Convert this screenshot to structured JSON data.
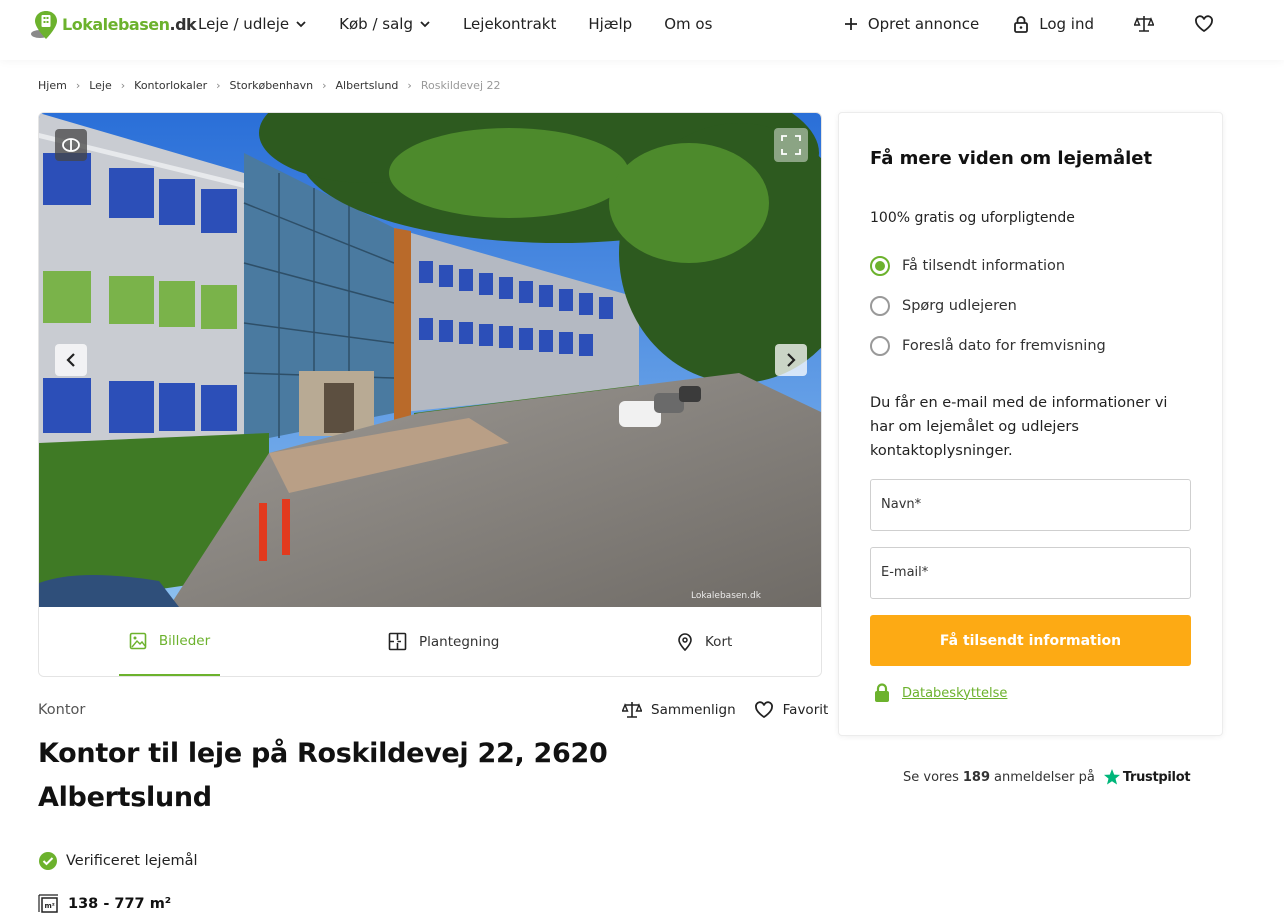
{
  "header": {
    "logo_text": "Lokalebasen",
    "logo_tld": ".dk",
    "nav": [
      {
        "label": "Leje / udleje"
      },
      {
        "label": "Køb / salg"
      },
      {
        "label": "Lejekontrakt"
      },
      {
        "label": "Hjælp"
      },
      {
        "label": "Om os"
      }
    ],
    "create_listing": "Opret annonce",
    "login": "Log ind"
  },
  "breadcrumb": [
    "Hjem",
    "Leje",
    "Kontorlokaler",
    "Storkøbenhavn",
    "Albertslund",
    "Roskildevej 22"
  ],
  "gallery": {
    "watermark": "Lokalebasen.dk",
    "tabs": [
      "Billeder",
      "Plantegning",
      "Kort"
    ],
    "active_tab": "Billeder"
  },
  "listing": {
    "category": "Kontor",
    "compare": "Sammenlign",
    "favorite": "Favorit",
    "title": "Kontor til leje på Roskildevej 22, 2620 Albertslund",
    "verified": "Verificeret lejemål",
    "size": "138 - 777 m²"
  },
  "form": {
    "title": "Få mere viden om lejemålet",
    "subtitle": "100% gratis og uforpligtende",
    "options": [
      "Få tilsendt information",
      "Spørg udlejeren",
      "Foreslå dato for fremvisning"
    ],
    "selected_option": "Få tilsendt information",
    "info": "Du får en e-mail med de informationer vi har om lejemålet og udlejers kontaktoplysninger.",
    "name_placeholder": "Navn*",
    "email_placeholder": "E-mail*",
    "submit": "Få tilsendt information",
    "privacy": "Databeskyttelse"
  },
  "trustpilot": {
    "prefix": "Se vores",
    "count": "189",
    "suffix": "anmeldelser på",
    "brand": "Trustpilot"
  },
  "colors": {
    "brand_green": "#6cb22d",
    "cta_orange": "#fdaa14"
  }
}
